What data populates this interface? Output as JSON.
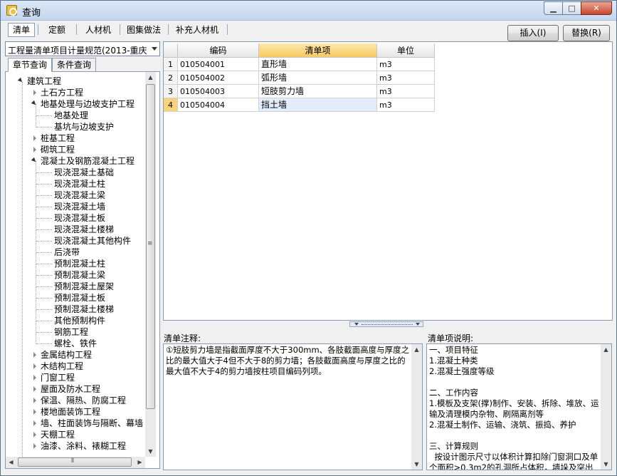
{
  "window": {
    "title": "查询"
  },
  "toolbar": {
    "tabs": [
      "清单",
      "定额",
      "人材机",
      "图集做法",
      "补充人材机"
    ],
    "insert_label": "插入(I)",
    "replace_label": "替换(R)"
  },
  "left": {
    "dropdown_value": "工程量清单项目计量规范(2013-重庆",
    "subtabs": [
      "章节查询",
      "条件查询"
    ],
    "tree": [
      "建筑工程",
      "土石方工程",
      "地基处理与边坡支护工程",
      "地基处理",
      "基坑与边坡支护",
      "桩基工程",
      "砌筑工程",
      "混凝土及钢筋混凝土工程",
      "现浇混凝土基础",
      "现浇混凝土柱",
      "现浇混凝土梁",
      "现浇混凝土墙",
      "现浇混凝土板",
      "现浇混凝土楼梯",
      "现浇混凝土其他构件",
      "后浇带",
      "预制混凝土柱",
      "预制混凝土梁",
      "预制混凝土屋架",
      "预制混凝土板",
      "预制混凝土楼梯",
      "其他预制构件",
      "钢筋工程",
      "螺栓、铁件",
      "金属结构工程",
      "木结构工程",
      "门窗工程",
      "屋面及防水工程",
      "保温、隔热、防腐工程",
      "楼地面装饰工程",
      "墙、柱面装饰与隔断、幕墙",
      "天棚工程",
      "油漆、涂料、裱糊工程"
    ]
  },
  "grid": {
    "headers": [
      "编码",
      "清单项",
      "单位"
    ],
    "rows": [
      {
        "no": "1",
        "code": "010504001",
        "name": "直形墙",
        "unit": "m3"
      },
      {
        "no": "2",
        "code": "010504002",
        "name": "弧形墙",
        "unit": "m3"
      },
      {
        "no": "3",
        "code": "010504003",
        "name": "短肢剪力墙",
        "unit": "m3"
      },
      {
        "no": "4",
        "code": "010504004",
        "name": "挡土墙",
        "unit": "m3"
      }
    ]
  },
  "notes": {
    "label": "清单注释:",
    "text": "①短肢剪力墙是指截面厚度不大于300mm、各肢截面高度与厚度之比的最大值大于4但不大于8的剪力墙；各肢截面高度与厚度之比的最大值不大于4的剪力墙按柱项目编码列项。"
  },
  "desc": {
    "label": "清单项说明:",
    "text": "一、项目特征\n1.混凝土种类\n2.混凝土强度等级\n\n二、工作内容\n1.模板及支架(撑)制作、安装、拆除、堆放、运输及清理模内杂物、刷隔离剂等\n2.混凝土制作、运输、浇筑、振捣、养护\n\n三、计算规则\n  按设计图示尺寸以体积计算扣除门窗洞口及单个面积>0.3m2的孔洞所占体积，墙垛及突出墙面部分并入墙体体积计算内"
  }
}
